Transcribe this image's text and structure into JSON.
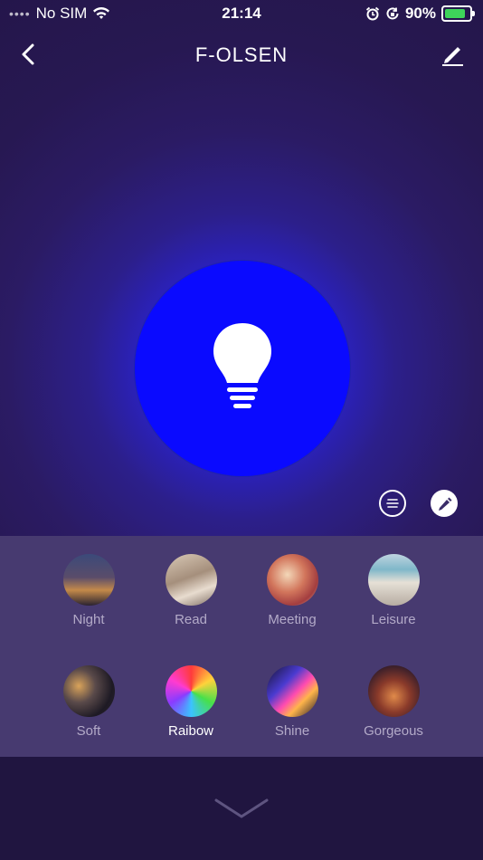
{
  "status_bar": {
    "carrier": "No SIM",
    "time": "21:14",
    "battery": "90%"
  },
  "header": {
    "title": "F-OLSEN"
  },
  "light": {
    "color": "#0a0aff"
  },
  "scenes": [
    {
      "label": "Night",
      "icon": "night-scene-thumb"
    },
    {
      "label": "Read",
      "icon": "read-scene-thumb"
    },
    {
      "label": "Meeting",
      "icon": "meeting-scene-thumb"
    },
    {
      "label": "Leisure",
      "icon": "leisure-scene-thumb"
    },
    {
      "label": "Soft",
      "icon": "soft-scene-thumb"
    },
    {
      "label": "Raibow",
      "icon": "rainbow-scene-thumb",
      "selected": true
    },
    {
      "label": "Shine",
      "icon": "shine-scene-thumb"
    },
    {
      "label": "Gorgeous",
      "icon": "gorgeous-scene-thumb"
    }
  ]
}
